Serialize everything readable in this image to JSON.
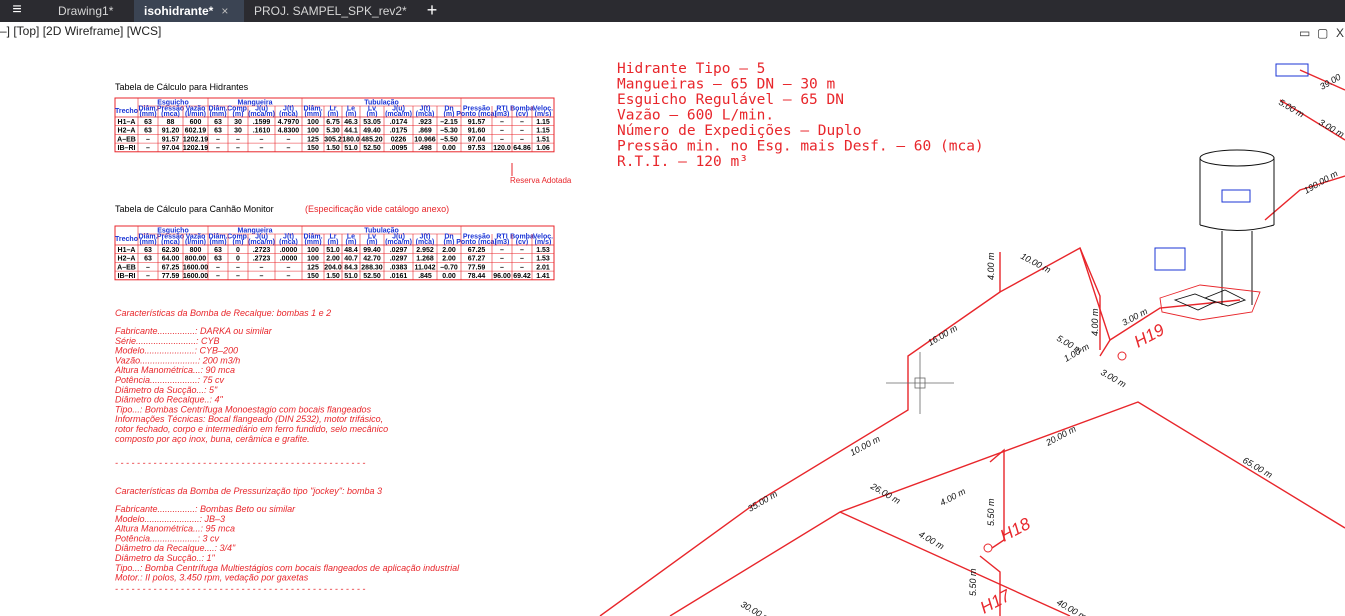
{
  "tabs": [
    {
      "label": "Drawing1*",
      "active": false
    },
    {
      "label": "isohidrante*",
      "active": true,
      "close": "×"
    },
    {
      "label": "PROJ. SAMPEL_SPK_rev2*",
      "active": false
    }
  ],
  "new_tab": "+",
  "menu_icon": "≡",
  "viewport_label": "–] [Top] [2D Wireframe] [WCS]",
  "window_controls": {
    "minimize": "▭",
    "restore": "▢",
    "close": "X"
  },
  "table1": {
    "title": "Tabela de Cálculo para Hidrantes",
    "groups": [
      "Esguicho",
      "Mangueira",
      "Tubulação"
    ],
    "headers": [
      "Trecho",
      "Diâm. (mm)",
      "Pressão (mca)",
      "Vazão (l/min)",
      "Diâm. (mm)",
      "Comp. (m)",
      "J(u) (mca/m)",
      "J(t) (mca)",
      "Diâm. (mm)",
      "Lr (m)",
      "Le (m)",
      "Lv (m)",
      "J(u) (mca/m)",
      "J(t) (mca)",
      "Dn (m)",
      "Pressão Ponto (mca)",
      "RTI (m3)",
      "Bomba (cv)",
      "Veloc. (m/s)"
    ],
    "rows": [
      [
        "H1–A",
        "63",
        "88",
        "600",
        "63",
        "30",
        ".1599",
        "4.7970",
        "100",
        "6.75",
        "46.3",
        "53.05",
        ".0174",
        ".923",
        "–2.15",
        "91.57",
        "–",
        "–",
        "1.15"
      ],
      [
        "H2–A",
        "63",
        "91.20",
        "602.19",
        "63",
        "30",
        ".1610",
        "4.8300",
        "100",
        "5.30",
        "44.1",
        "49.40",
        ".0175",
        ".869",
        "–5.30",
        "91.60",
        "–",
        "–",
        "1.15"
      ],
      [
        "A–EB",
        "–",
        "91.57",
        "1202.19",
        "–",
        "–",
        "–",
        "–",
        "125",
        "305.2",
        "180.0",
        "485.20",
        "0226",
        "10.966",
        "–5.50",
        "97.04",
        "–",
        "–",
        "1.51"
      ],
      [
        "IB–RI",
        "–",
        "97.04",
        "1202.19",
        "–",
        "–",
        "–",
        "–",
        "150",
        "1.50",
        "51.0",
        "52.50",
        ".0095",
        ".498",
        "0.00",
        "97.53",
        "120.0",
        "64.86",
        "1.06"
      ]
    ],
    "note": "Reserva Adotada"
  },
  "table2": {
    "title": "Tabela de Cálculo para Canhão Monitor",
    "title_note": "(Especificação vide catálogo anexo)",
    "groups": [
      "Esguicho",
      "Mangueira",
      "Tubulação"
    ],
    "headers": [
      "Trecho",
      "Diâm. (mm)",
      "Pressão (mca)",
      "Vazão (l/min)",
      "Diâm. (mm)",
      "Comp. (m)",
      "J(u) (mca/m)",
      "J(t) (mca)",
      "Diâm. (mm)",
      "Lr (m)",
      "Le (m)",
      "Lv (m)",
      "J(u) (mca/m)",
      "J(t) (mca)",
      "Dn (m)",
      "Pressão Ponto (mca)",
      "RTI (m3)",
      "Bomba (cv)",
      "Veloc. (m/s)"
    ],
    "rows": [
      [
        "H1–A",
        "63",
        "62.30",
        "800",
        "63",
        "0",
        ".2723",
        ".0000",
        "100",
        "51.0",
        "48.4",
        "99.40",
        ".0297",
        "2.952",
        "2.00",
        "67.25",
        "–",
        "–",
        "1.53"
      ],
      [
        "H2–A",
        "63",
        "64.00",
        "800.00",
        "63",
        "0",
        ".2723",
        ".0000",
        "100",
        "2.00",
        "40.7",
        "42.70",
        ".0297",
        "1.268",
        "2.00",
        "67.27",
        "–",
        "–",
        "1.53"
      ],
      [
        "A–EB",
        "–",
        "67.25",
        "1600.00",
        "–",
        "–",
        "–",
        "–",
        "125",
        "204.0",
        "84.3",
        "288.30",
        ".0383",
        "11.042",
        "–0.70",
        "77.59",
        "–",
        "–",
        "2.01"
      ],
      [
        "IB–RI",
        "–",
        "77.59",
        "1600.00",
        "–",
        "–",
        "–",
        "–",
        "150",
        "1.50",
        "51.0",
        "52.50",
        ".0161",
        ".845",
        "0.00",
        "78.44",
        "96.00",
        "69.42",
        "1.41"
      ]
    ]
  },
  "pump1": {
    "title": "Características da Bomba de Recalque: bombas 1 e 2",
    "lines": [
      "Fabricante...............: DARKA ou similar",
      "Série........................: CYB",
      "Modelo....................: CYB–200",
      "Vazão.......................: 200 m3/h",
      "Altura Manométrica...: 90 mca",
      "Potência...................: 75 cv",
      "Diâmetro da Sucção...: 5\"",
      "Diâmetro do Recalque..: 4\"",
      "Tipo...: Bombas Centrífuga Monoestagio com bocais flangeados",
      "Informações Técnicas: Bocal flangeado (DIN 2532), motor trifásico,",
      "rotor fechado, corpo e intermediário em ferro fundido, selo mecânico",
      "composto por aço inox, buna, cerâmica e grafite."
    ],
    "divider": "- - - - - - - - - - - - - - - - - - - - - - - - - - - - - - - - - - - - - - - - - - - - - -"
  },
  "pump2": {
    "title": "Características da Bomba de Pressurização tipo \"jockey\": bomba 3",
    "lines": [
      "Fabricante...............: Bombas Beto ou similar",
      "Modelo......................: JB–3",
      "Altura Manométrica...: 95 mca",
      "Potência...................: 3 cv",
      "Diâmetro da Recalque....: 3/4\"",
      "Diâmetro da Sucção..: 1\"",
      "Tipo...: Bomba Centrífuga Multiestágios com bocais flangeados de aplicação industrial",
      "Motor.: II polos, 3.450 rpm, vedação por gaxetas"
    ],
    "divider": "- - - - - - - - - - - - - - - - - - - - - - - - - - - - - - - - - - - - - - - - - - - - - -"
  },
  "spec": [
    "Hidrante Tipo – 5",
    "Mangueiras – 65 DN – 30 m",
    "Esguicho Regulável – 65 DN",
    "Vazão – 600 L/min.",
    "Número de Expedições – Duplo",
    "Pressão min. no Esg. mais Desf. – 60 (mca)",
    "R.T.I. – 120 m³"
  ],
  "dimensions": [
    "39.00",
    "5.00 m",
    "3.00 m",
    "190.00 m",
    "10.00 m",
    "4.00 m",
    "16.00 m",
    "3.00 m",
    "5.00 m",
    "1.00 m",
    "3.00 m",
    "4.00 m",
    "10.00 m",
    "20.00 m",
    "65.00 m",
    "35.00 m",
    "26.00 m",
    "4.00 m",
    "5.50 m",
    "4.00 m",
    "5.50 m",
    "30.00 m",
    "40.00 m"
  ],
  "hydrant_labels": [
    "H19",
    "H18",
    "H17"
  ],
  "colors": {
    "tabbar": "#2b2b30",
    "active_tab": "#3b4453",
    "cad_red": "#e8262b",
    "cad_blue": "#1b35d6"
  }
}
